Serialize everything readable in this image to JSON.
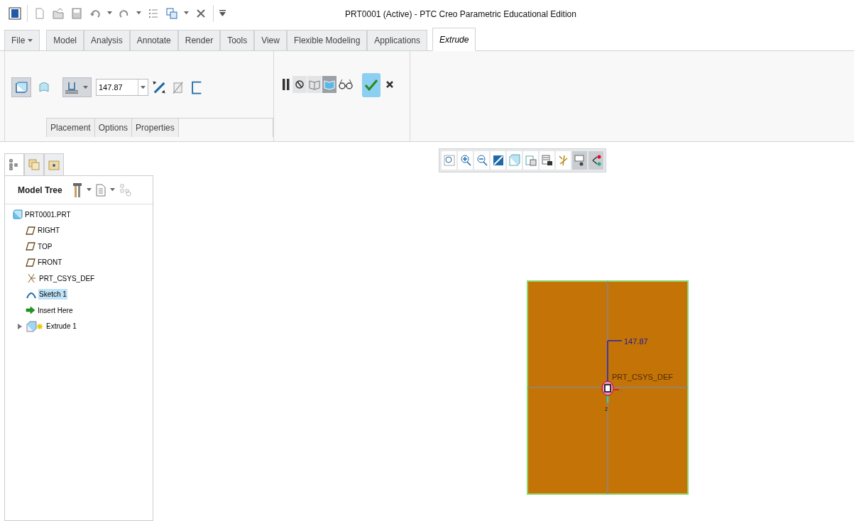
{
  "window": {
    "title": "PRT0001 (Active) - PTC Creo Parametric Educational Edition"
  },
  "tabs": [
    {
      "label": "File",
      "selected": false,
      "menu": true
    },
    {
      "label": "Model",
      "selected": false
    },
    {
      "label": "Analysis",
      "selected": false
    },
    {
      "label": "Annotate",
      "selected": false
    },
    {
      "label": "Render",
      "selected": false
    },
    {
      "label": "Tools",
      "selected": false
    },
    {
      "label": "View",
      "selected": false
    },
    {
      "label": "Flexible Modeling",
      "selected": false
    },
    {
      "label": "Applications",
      "selected": false
    },
    {
      "label": "Extrude",
      "selected": true
    }
  ],
  "ribbon": {
    "shape_types": [
      {
        "kind": "solid",
        "selected": true
      },
      {
        "kind": "surface",
        "selected": false
      }
    ],
    "depth_option": {
      "selected": true
    },
    "depth_value": "147.87",
    "subtabs": [
      "Placement",
      "Options",
      "Properties"
    ],
    "preview_modes": [
      {
        "kind": "no-preview",
        "selected": false
      },
      {
        "kind": "geometry",
        "selected": false
      },
      {
        "kind": "feature",
        "selected": true
      }
    ]
  },
  "panel_tabs": [
    {
      "kind": "tree",
      "selected": true
    },
    {
      "kind": "folder",
      "selected": false
    },
    {
      "kind": "favorites",
      "selected": false
    }
  ],
  "panel": {
    "title": "Model Tree"
  },
  "tree": [
    {
      "kind": "part",
      "label": "PRT0001.PRT",
      "selected": false,
      "children": [
        {
          "kind": "plane",
          "label": "RIGHT",
          "selected": false
        },
        {
          "kind": "plane",
          "label": "TOP",
          "selected": false
        },
        {
          "kind": "plane",
          "label": "FRONT",
          "selected": false
        },
        {
          "kind": "csys",
          "label": "PRT_CSYS_DEF",
          "selected": false
        },
        {
          "kind": "sketch",
          "label": "Sketch 1",
          "selected": true
        },
        {
          "kind": "insert",
          "label": "Insert Here",
          "selected": false
        },
        {
          "kind": "extrude",
          "label": "Extrude 1",
          "selected": false,
          "expanded": false
        }
      ]
    }
  ],
  "view_toolbar": [
    {
      "kind": "refit",
      "selected": false
    },
    {
      "kind": "zoom-in",
      "selected": false
    },
    {
      "kind": "zoom-out",
      "selected": false
    },
    {
      "kind": "repaint",
      "selected": false
    },
    {
      "kind": "display-style",
      "selected": false
    },
    {
      "kind": "saved-views",
      "selected": false
    },
    {
      "kind": "view-manager",
      "selected": false
    },
    {
      "kind": "datum-display",
      "selected": false
    },
    {
      "kind": "annotations",
      "selected": true
    },
    {
      "kind": "spin-center",
      "selected": true
    }
  ],
  "canvas": {
    "dimension": "147.87",
    "csys_label": "PRT_CSYS_DEF",
    "x_label": "x",
    "z_label": "z"
  }
}
